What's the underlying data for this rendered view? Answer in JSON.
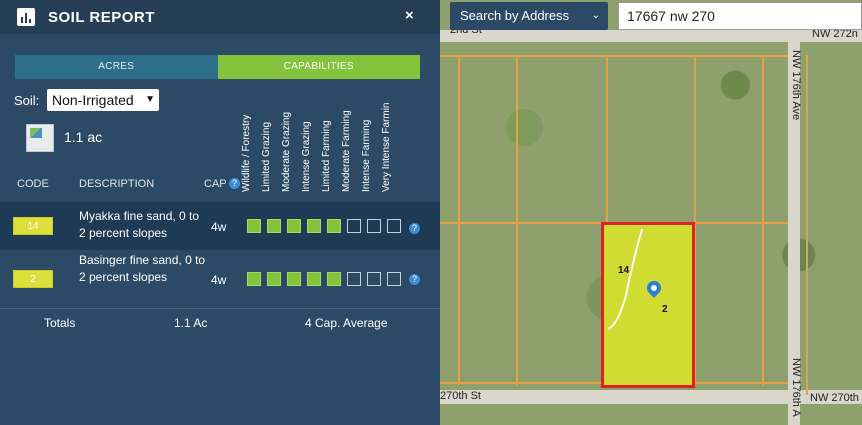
{
  "header": {
    "title": "SOIL REPORT",
    "close": "×"
  },
  "tabs": [
    {
      "label": "ACRES",
      "active": false
    },
    {
      "label": "CAPABILITIES",
      "active": true
    }
  ],
  "soil": {
    "label": "Soil:",
    "selected": "Non-Irrigated"
  },
  "acres": "1.1 ac",
  "capability_columns": [
    "Wildlife / Forestry",
    "Limited Grazing",
    "Moderate Grazing",
    "Intense Grazing",
    "Limited Farming",
    "Moderate Farming",
    "Intense Farming",
    "Very Intense Farmin"
  ],
  "table_headers": {
    "code": "CODE",
    "description": "DESCRIPTION",
    "cap": "CAP"
  },
  "rows": [
    {
      "code": "14",
      "description": "Myakka fine sand, 0 to 2 percent slopes",
      "cap": "4w",
      "filled": 5
    },
    {
      "code": "2",
      "description": "Basinger fine sand, 0 to 2 percent slopes",
      "cap": "4w",
      "filled": 5
    }
  ],
  "totals": {
    "label": "Totals",
    "acres": "1.1 Ac",
    "average": "4 Cap. Average"
  },
  "search": {
    "button": "Search by Address",
    "value": "17667 nw 270"
  },
  "map": {
    "labels": {
      "top_street": "2nd St",
      "top_right": "NW 272n",
      "ave": "NW 176th Ave",
      "ave2": "NW 176th A",
      "bottom_left": "270th St",
      "bottom_right": "NW 270th"
    },
    "parcel_labels": [
      "14",
      "2"
    ]
  },
  "colors": {
    "accent_green": "#84c33c",
    "code_yellow": "#dde03a",
    "selection_red": "#e21b1b"
  }
}
